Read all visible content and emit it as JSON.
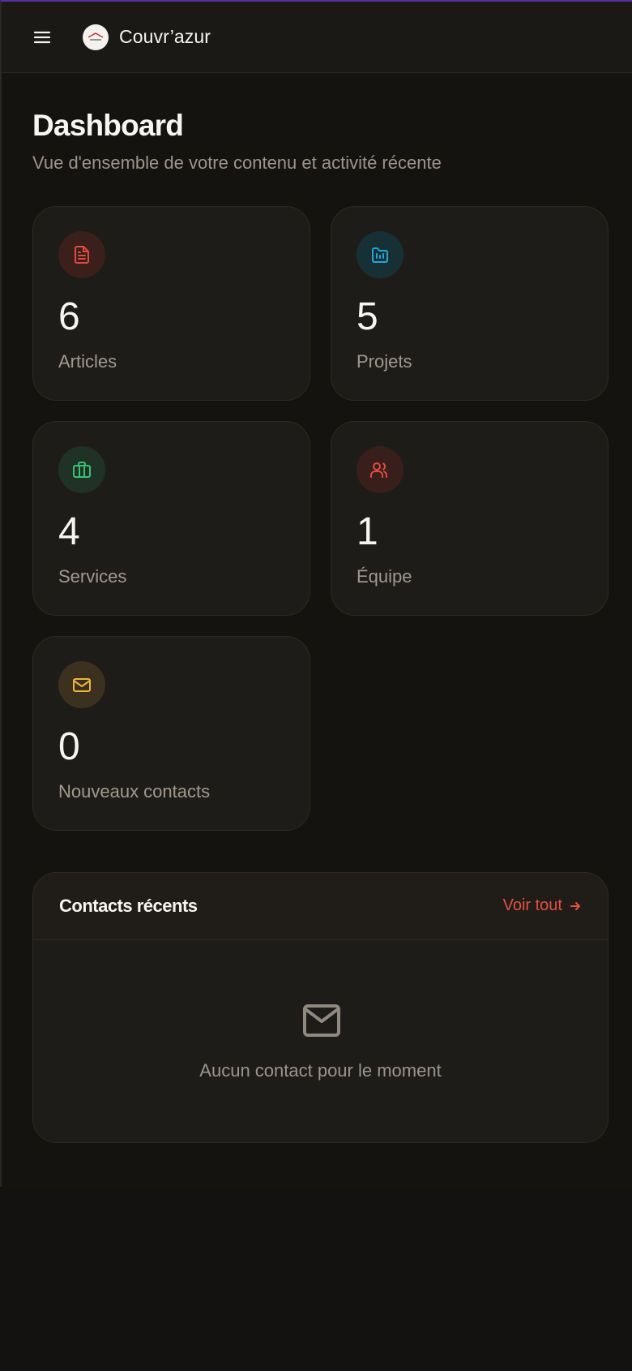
{
  "app": {
    "brand": "Couvr’azur"
  },
  "page": {
    "title": "Dashboard",
    "subtitle": "Vue d'ensemble de votre contenu et activité récente"
  },
  "stats": [
    {
      "value": "6",
      "label": "Articles",
      "icon": "file-text-icon",
      "color": "#e14b3f",
      "bg": "#3a1f1b"
    },
    {
      "value": "5",
      "label": "Projets",
      "icon": "folder-icon",
      "color": "#20a7d8",
      "bg": "#173036"
    },
    {
      "value": "4",
      "label": "Services",
      "icon": "briefcase-icon",
      "color": "#38c174",
      "bg": "#1f3225"
    },
    {
      "value": "1",
      "label": "Équipe",
      "icon": "users-icon",
      "color": "#e14b3f",
      "bg": "#381f1b"
    },
    {
      "value": "0",
      "label": "Nouveaux contacts",
      "icon": "mail-icon",
      "color": "#f0b43b",
      "bg": "#3b311e"
    }
  ],
  "contacts": {
    "title": "Contacts récents",
    "see_all": "Voir tout",
    "empty": "Aucun contact pour le moment"
  },
  "colors": {
    "accent": "#e14b3f",
    "background": "#15130f",
    "card": "#1e1c18"
  }
}
